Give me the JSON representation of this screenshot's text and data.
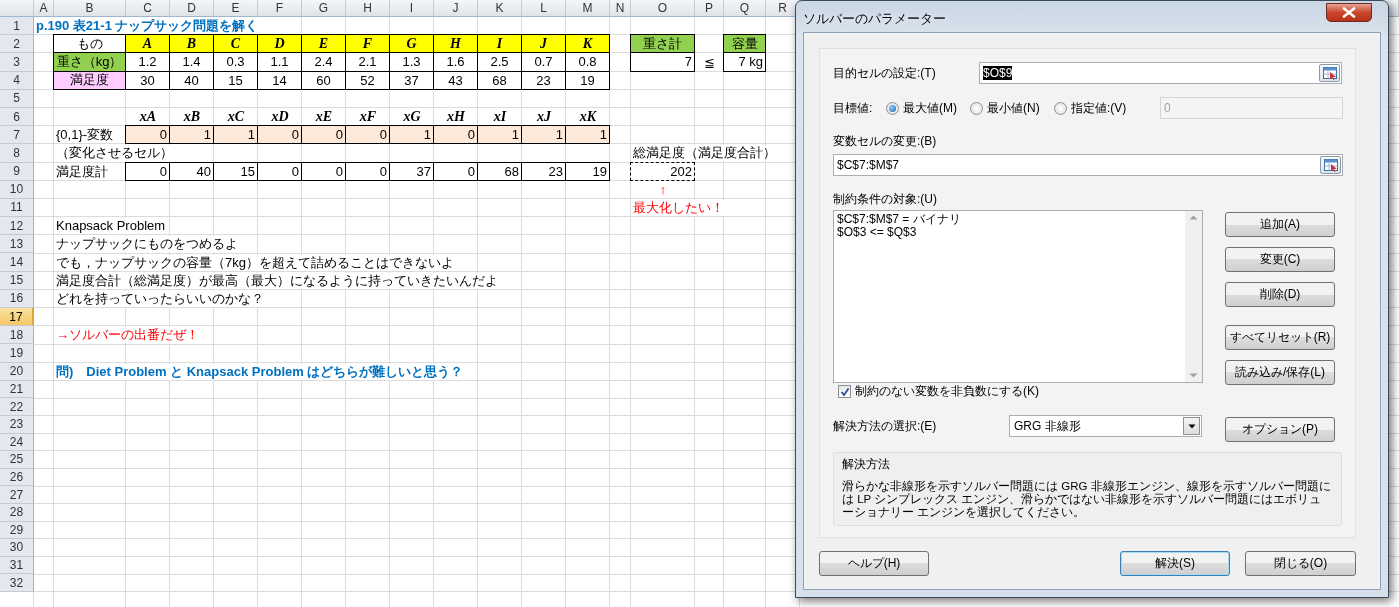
{
  "sheet": {
    "columns": [
      "A",
      "B",
      "C",
      "D",
      "E",
      "F",
      "G",
      "H",
      "I",
      "J",
      "K",
      "L",
      "M",
      "N",
      "O",
      "P",
      "Q",
      "R"
    ],
    "rows": [
      {
        "label": "1",
        "selected": false,
        "cells": [
          {
            "kind": "title",
            "text": "p.190 表21-1 ナップサック問題を解く"
          }
        ]
      },
      {
        "label": "2",
        "selected": false,
        "cells": [
          "",
          {
            "kind": "name",
            "text": "もの"
          },
          {
            "kind": "header",
            "text": "A"
          },
          {
            "kind": "header",
            "text": "B"
          },
          {
            "kind": "header",
            "text": "C"
          },
          {
            "kind": "header",
            "text": "D"
          },
          {
            "kind": "header",
            "text": "E"
          },
          {
            "kind": "header",
            "text": "F"
          },
          {
            "kind": "header",
            "text": "G"
          },
          {
            "kind": "header",
            "text": "H"
          },
          {
            "kind": "header",
            "text": "I"
          },
          {
            "kind": "header",
            "text": "J"
          },
          {
            "kind": "header",
            "text": "K"
          },
          "",
          {
            "kind": "green-header",
            "text": "重さ計"
          },
          "",
          {
            "kind": "green-header",
            "text": "容量"
          }
        ]
      },
      {
        "label": "3",
        "selected": false,
        "cells": [
          "",
          {
            "kind": "weight-label",
            "text": "重さ（kg）"
          },
          {
            "kind": "value",
            "text": "1.2"
          },
          {
            "kind": "value",
            "text": "1.4"
          },
          {
            "kind": "value",
            "text": "0.3"
          },
          {
            "kind": "value",
            "text": "1.1"
          },
          {
            "kind": "value",
            "text": "2.4"
          },
          {
            "kind": "value",
            "text": "2.1"
          },
          {
            "kind": "value",
            "text": "1.3"
          },
          {
            "kind": "value",
            "text": "1.6"
          },
          {
            "kind": "value",
            "text": "2.5"
          },
          {
            "kind": "value",
            "text": "0.7"
          },
          {
            "kind": "value",
            "text": "0.8"
          },
          "",
          {
            "kind": "total",
            "text": "7"
          },
          {
            "kind": "symbol",
            "text": "≦"
          },
          {
            "kind": "total",
            "text": "7 kg"
          }
        ]
      },
      {
        "label": "4",
        "selected": false,
        "cells": [
          "",
          {
            "kind": "satisfaction-label",
            "text": "満足度"
          },
          {
            "kind": "value",
            "text": "30"
          },
          {
            "kind": "value",
            "text": "40"
          },
          {
            "kind": "value",
            "text": "15"
          },
          {
            "kind": "value",
            "text": "14"
          },
          {
            "kind": "value",
            "text": "60"
          },
          {
            "kind": "value",
            "text": "52"
          },
          {
            "kind": "value",
            "text": "37"
          },
          {
            "kind": "value",
            "text": "43"
          },
          {
            "kind": "value",
            "text": "68"
          },
          {
            "kind": "value",
            "text": "23"
          },
          {
            "kind": "value",
            "text": "19"
          }
        ]
      },
      {
        "label": "5",
        "selected": false
      },
      {
        "label": "6",
        "selected": false,
        "cells": [
          "",
          "",
          {
            "kind": "variable-name",
            "text": "xA"
          },
          {
            "kind": "variable-name",
            "text": "xB"
          },
          {
            "kind": "variable-name",
            "text": "xC"
          },
          {
            "kind": "variable-name",
            "text": "xD"
          },
          {
            "kind": "variable-name",
            "text": "xE"
          },
          {
            "kind": "variable-name",
            "text": "xF"
          },
          {
            "kind": "variable-name",
            "text": "xG"
          },
          {
            "kind": "variable-name",
            "text": "xH"
          },
          {
            "kind": "variable-name",
            "text": "xI"
          },
          {
            "kind": "variable-name",
            "text": "xJ"
          },
          {
            "kind": "variable-name",
            "text": "xK"
          }
        ]
      },
      {
        "label": "7",
        "selected": false,
        "cells": [
          "",
          {
            "kind": "text",
            "text": "{0,1}-変数"
          },
          {
            "kind": "variable",
            "text": "0"
          },
          {
            "kind": "variable",
            "text": "1"
          },
          {
            "kind": "variable",
            "text": "1"
          },
          {
            "kind": "variable",
            "text": "0"
          },
          {
            "kind": "variable",
            "text": "0"
          },
          {
            "kind": "variable",
            "text": "0"
          },
          {
            "kind": "variable",
            "text": "1"
          },
          {
            "kind": "variable",
            "text": "0"
          },
          {
            "kind": "variable",
            "text": "1"
          },
          {
            "kind": "variable",
            "text": "1"
          },
          {
            "kind": "variable",
            "text": "1"
          }
        ]
      },
      {
        "label": "8",
        "selected": false,
        "cells": [
          "",
          {
            "kind": "text",
            "text": "（変化させるセル）"
          },
          "",
          "",
          "",
          "",
          "",
          "",
          "",
          "",
          "",
          "",
          "",
          "",
          {
            "kind": "text",
            "text": "総満足度（満足度合計）"
          }
        ]
      },
      {
        "label": "9",
        "selected": false,
        "cells": [
          "",
          {
            "kind": "text",
            "text": "満足度計"
          },
          {
            "kind": "sum",
            "text": "0"
          },
          {
            "kind": "sum",
            "text": "40"
          },
          {
            "kind": "sum",
            "text": "15"
          },
          {
            "kind": "sum",
            "text": "0"
          },
          {
            "kind": "sum",
            "text": "0"
          },
          {
            "kind": "sum",
            "text": "0"
          },
          {
            "kind": "sum",
            "text": "37"
          },
          {
            "kind": "sum",
            "text": "0"
          },
          {
            "kind": "sum",
            "text": "68"
          },
          {
            "kind": "sum",
            "text": "23"
          },
          {
            "kind": "sum",
            "text": "19"
          },
          "",
          {
            "kind": "dashed-total",
            "text": "202"
          }
        ]
      },
      {
        "label": "10",
        "selected": false,
        "cells": [
          "",
          "",
          "",
          "",
          "",
          "",
          "",
          "",
          "",
          "",
          "",
          "",
          "",
          "",
          {
            "kind": "arrow",
            "text": "↑"
          }
        ]
      },
      {
        "label": "11",
        "selected": false,
        "cells": [
          "",
          "",
          "",
          "",
          "",
          "",
          "",
          "",
          "",
          "",
          "",
          "",
          "",
          "",
          {
            "kind": "note",
            "text": "最大化したい！"
          }
        ]
      },
      {
        "label": "12",
        "selected": false,
        "cells": [
          "",
          {
            "kind": "text",
            "text": "Knapsack Problem"
          }
        ]
      },
      {
        "label": "13",
        "selected": false,
        "cells": [
          "",
          {
            "kind": "text",
            "text": "ナップサックにものをつめるよ"
          }
        ]
      },
      {
        "label": "14",
        "selected": false,
        "cells": [
          "",
          {
            "kind": "text",
            "text": "でも，ナップサックの容量（7kg）を超えて詰めることはできないよ"
          }
        ]
      },
      {
        "label": "15",
        "selected": false,
        "cells": [
          "",
          {
            "kind": "text",
            "text": "満足度合計（総満足度）が最高（最大）になるように持っていきたいんだよ"
          }
        ]
      },
      {
        "label": "16",
        "selected": false,
        "cells": [
          "",
          {
            "kind": "text",
            "text": "どれを持っていったらいいのかな？"
          }
        ]
      },
      {
        "label": "17",
        "selected": true
      },
      {
        "label": "18",
        "selected": false,
        "cells": [
          "",
          {
            "kind": "note",
            "text": "→ソルバーの出番だぜ！"
          }
        ]
      },
      {
        "label": "19",
        "selected": false
      },
      {
        "label": "20",
        "selected": false,
        "cells": [
          "",
          {
            "kind": "question",
            "text": "問)　Diet Problem と Knapsack Problem はどちらが難しいと思う？"
          }
        ]
      },
      {
        "label": "21",
        "selected": false
      },
      {
        "label": "22",
        "selected": false
      },
      {
        "label": "23",
        "selected": false
      },
      {
        "label": "24",
        "selected": false
      },
      {
        "label": "25",
        "selected": false
      },
      {
        "label": "26",
        "selected": false
      },
      {
        "label": "27",
        "selected": false
      },
      {
        "label": "28",
        "selected": false
      },
      {
        "label": "29",
        "selected": false
      },
      {
        "label": "30",
        "selected": false
      },
      {
        "label": "31",
        "selected": false
      },
      {
        "label": "32",
        "selected": false
      }
    ]
  },
  "dialog": {
    "title": "ソルバーのパラメーター",
    "objective": {
      "label": "目的セルの設定:(T)",
      "value": "$O$9",
      "highlighted": true
    },
    "goal": {
      "label": "目標値:",
      "options": [
        {
          "label": "最大値(M)",
          "selected": true
        },
        {
          "label": "最小値(N)",
          "selected": false
        },
        {
          "label": "指定値:(V)",
          "selected": false
        }
      ],
      "value": "0",
      "disabled": true
    },
    "variables": {
      "label": "変数セルの変更:(B)",
      "value": "$C$7:$M$7"
    },
    "constraints": {
      "label": "制約条件の対象:(U)",
      "items": [
        "$C$7:$M$7 = バイナリ",
        "$O$3 <= $Q$3"
      ]
    },
    "side_buttons": [
      "追加(A)",
      "変更(C)",
      "削除(D)",
      "すべてリセット(R)",
      "読み込み/保存(L)"
    ],
    "nonnegative": {
      "label": "制約のない変数を非負数にする(K)",
      "checked": true
    },
    "method": {
      "label": "解決方法の選択:(E)",
      "value": "GRG 非線形"
    },
    "options_button": "オプション(P)",
    "method_info": {
      "title": "解決方法",
      "text": "滑らかな非線形を示すソルバー問題には GRG 非線形エンジン、線形を示すソルバー問題には LP シンプレックス エンジン、滑らかではない非線形を示すソルバー問題にはエボリューショナリー エンジンを選択してください。"
    },
    "footer_buttons": [
      {
        "label": "ヘルプ(H)",
        "default": false
      },
      {
        "label": "解決(S)",
        "default": true
      },
      {
        "label": "閉じる(O)",
        "default": false
      }
    ]
  }
}
